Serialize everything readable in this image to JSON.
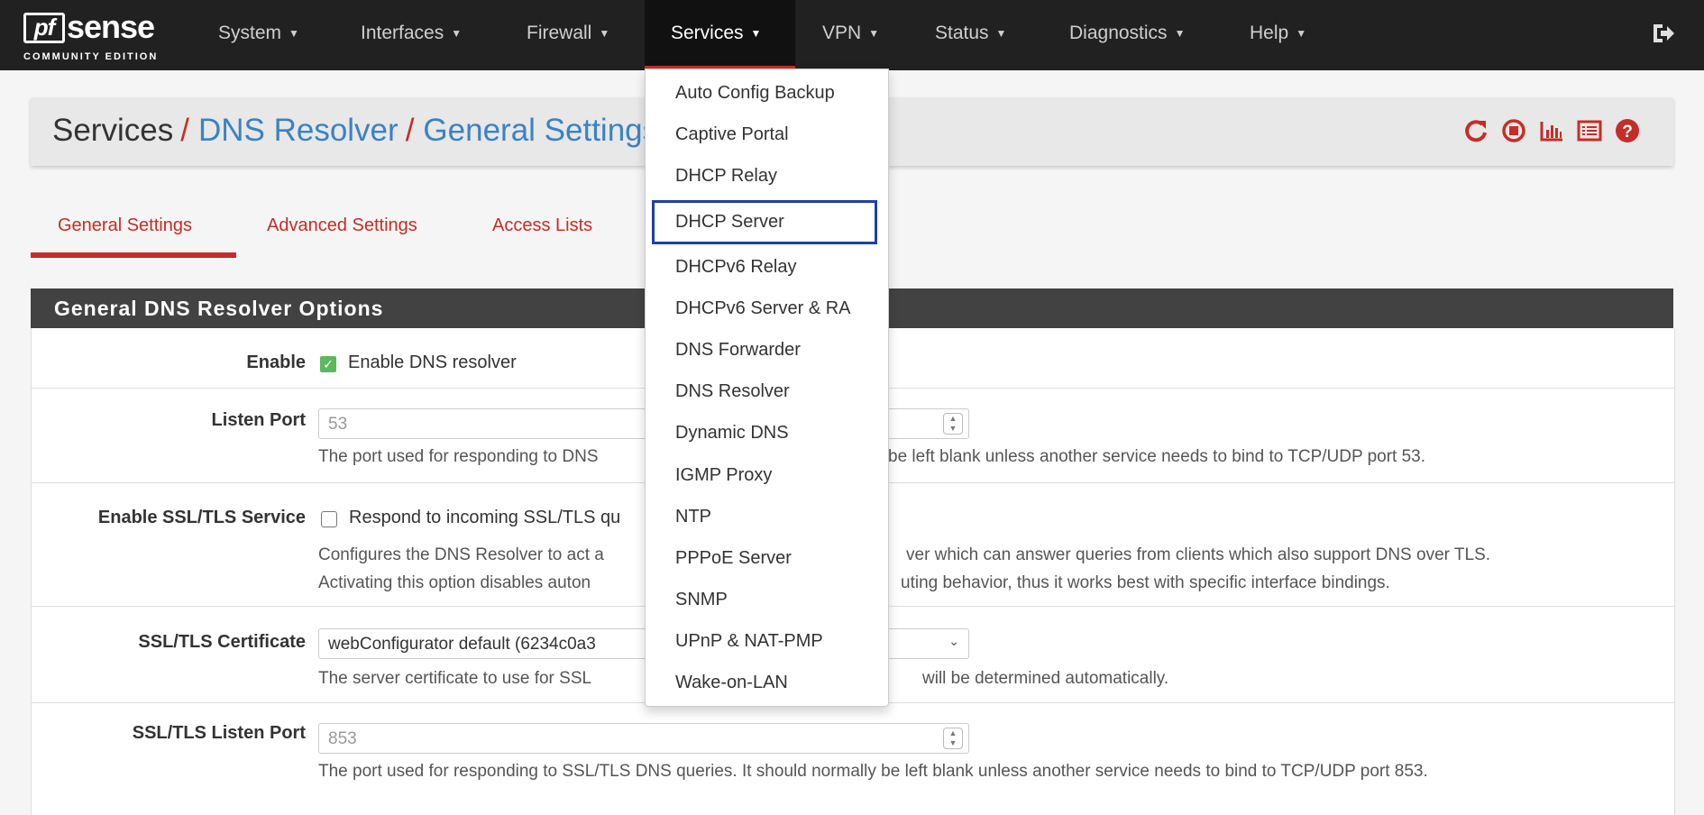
{
  "brand": {
    "name_prefix": "pf",
    "name_suffix": "sense",
    "edition": "COMMUNITY EDITION"
  },
  "nav": {
    "items": [
      "System",
      "Interfaces",
      "Firewall",
      "Services",
      "VPN",
      "Status",
      "Diagnostics",
      "Help"
    ],
    "active": "Services",
    "logout_icon": "sign-out-icon"
  },
  "breadcrumb": {
    "root": "Services",
    "section": "DNS Resolver",
    "page": "General Settings",
    "separator": "/"
  },
  "header_icons": [
    "reload-icon",
    "stop-icon",
    "chart-icon",
    "list-icon",
    "help-icon"
  ],
  "tabs": [
    "General Settings",
    "Advanced Settings",
    "Access Lists"
  ],
  "active_tab": "General Settings",
  "panel": {
    "title": "General DNS Resolver Options"
  },
  "form": {
    "enable": {
      "label": "Enable",
      "checkbox_label": "Enable DNS resolver",
      "checked": true
    },
    "listen_port": {
      "label": "Listen Port",
      "value": "53",
      "help_left": "The port used for responding to DNS",
      "help_right": "be left blank unless another service needs to bind to TCP/UDP port 53."
    },
    "ssl_tls": {
      "label": "Enable SSL/TLS Service",
      "checkbox_label": "Respond to incoming SSL/TLS qu",
      "checked": false,
      "help_line1_left": "Configures the DNS Resolver to act a",
      "help_line1_right": "ver which can answer queries from clients which also support DNS over TLS.",
      "help_line2_left": "Activating this option disables auton",
      "help_line2_right": "uting behavior, thus it works best with specific interface bindings."
    },
    "ssl_cert": {
      "label": "SSL/TLS Certificate",
      "value": "webConfigurator default (6234c0a3",
      "help_left": "The server certificate to use for SSL",
      "help_right": "will be determined automatically."
    },
    "ssl_port": {
      "label": "SSL/TLS Listen Port",
      "placeholder": "853",
      "help": "The port used for responding to SSL/TLS DNS queries. It should normally be left blank unless another service needs to bind to TCP/UDP port 853."
    }
  },
  "services_menu": {
    "items": [
      "Auto Config Backup",
      "Captive Portal",
      "DHCP Relay",
      "DHCP Server",
      "DHCPv6 Relay",
      "DHCPv6 Server & RA",
      "DNS Forwarder",
      "DNS Resolver",
      "Dynamic DNS",
      "IGMP Proxy",
      "NTP",
      "PPPoE Server",
      "SNMP",
      "UPnP & NAT-PMP",
      "Wake-on-LAN"
    ],
    "highlighted": "DHCP Server"
  },
  "colors": {
    "accent": "#c42e28",
    "link": "#3a82c4",
    "navbar": "#212121",
    "highlight_box": "#1f3fa6",
    "check_green": "#5cb85c"
  }
}
